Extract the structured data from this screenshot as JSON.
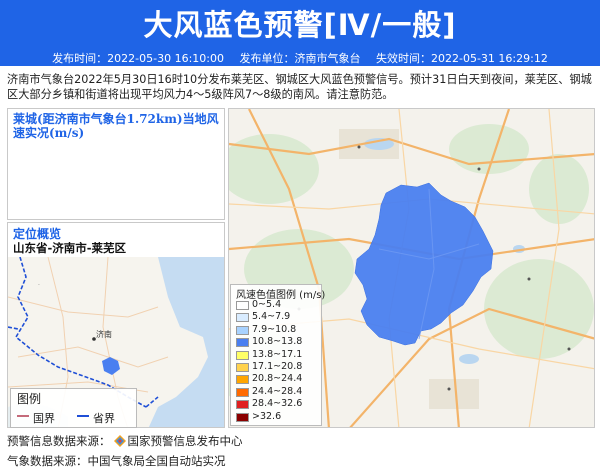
{
  "header": {
    "title": "大风蓝色预警[Ⅳ/一般]",
    "issue_time_label": "发布时间：2022-05-30 16:10:00",
    "issuer_label": "发布单位：济南市气象台",
    "expire_label": "失效时间：2022-05-31 16:29:12",
    "bg_color": "#1f64e6"
  },
  "description": "济南市气象台2022年5月30日16时10分发布莱芜区、钢城区大风蓝色预警信号。预计31日白天到夜间，莱芜区、钢城区大部分乡镇和街道将出现平均风力4～5级阵风7～8级的南风。请注意防范。",
  "wind_panel": {
    "title": "莱城(距济南市气象台1.72km)当地风速实况(m/s)"
  },
  "location_panel": {
    "title": "定位概览",
    "subtitle": "山东省-济南市-莱芜区",
    "city_label": "济南",
    "legend_title": "图例",
    "legend_items": [
      {
        "label": "国界",
        "color": "#c46a7a"
      },
      {
        "label": "省界",
        "color": "#1f4fd6"
      }
    ]
  },
  "main_map": {
    "warning_area_color": "#4a7ff0",
    "legend_title": "风速色值图例 (m/s)",
    "legend": [
      {
        "label": "0~5.4",
        "color": "#ffffff"
      },
      {
        "label": "5.4~7.9",
        "color": "#d9ecff"
      },
      {
        "label": "7.9~10.8",
        "color": "#a8d2ff"
      },
      {
        "label": "10.8~13.8",
        "color": "#4a7ff0"
      },
      {
        "label": "13.8~17.1",
        "color": "#ffff66"
      },
      {
        "label": "17.1~20.8",
        "color": "#ffd24d"
      },
      {
        "label": "20.8~24.4",
        "color": "#ffa500"
      },
      {
        "label": "24.4~28.4",
        "color": "#ff6a00"
      },
      {
        "label": "28.4~32.6",
        "color": "#e02020"
      },
      {
        "label": ">32.6",
        "color": "#8b0000"
      }
    ]
  },
  "footer": {
    "warning_source_label": "预警信息数据来源：",
    "warning_source": "国家预警信息发布中心",
    "weather_source_label": "气象数据来源：",
    "weather_source": "中国气象局全国自动站实况"
  }
}
